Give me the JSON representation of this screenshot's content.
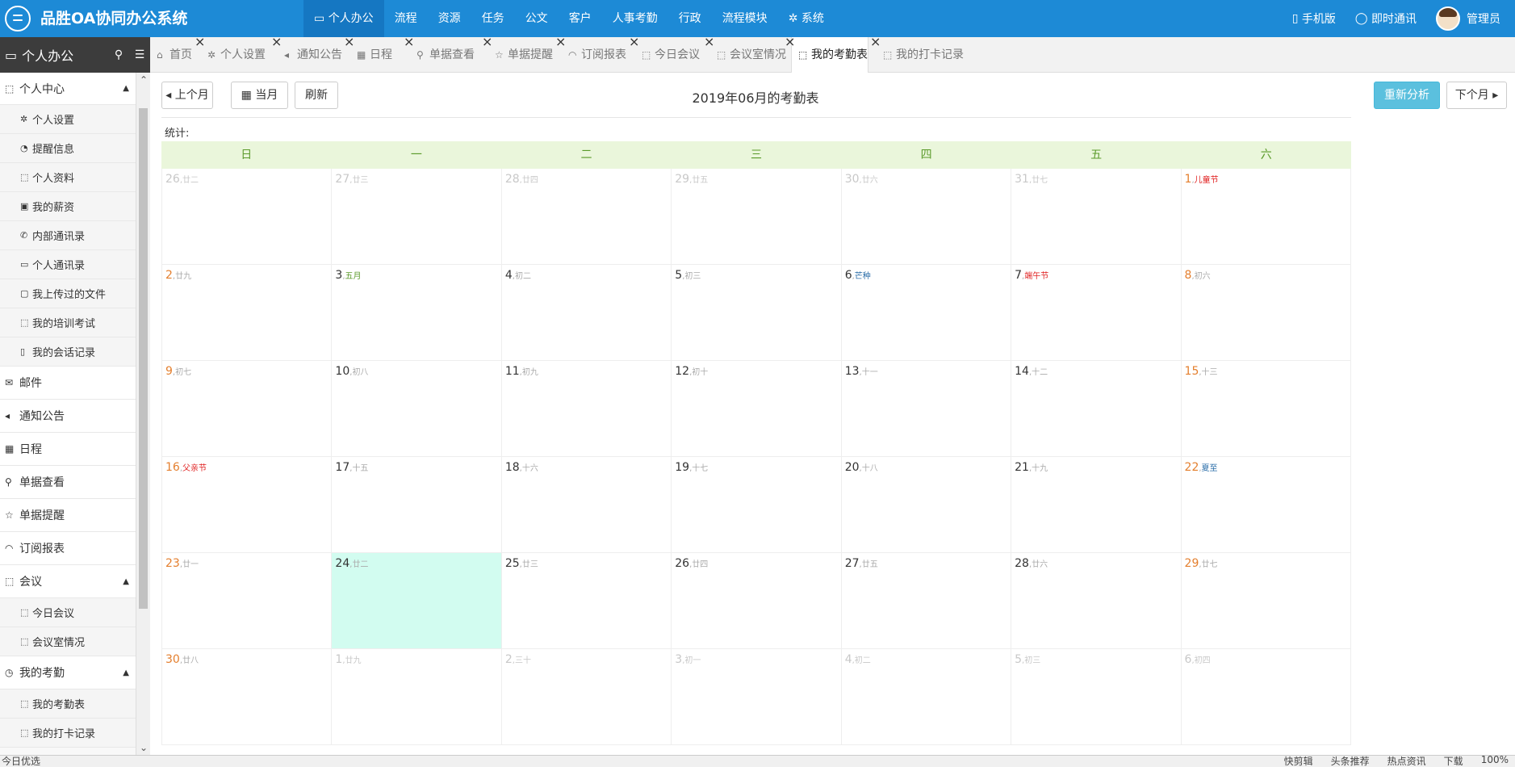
{
  "app": {
    "title": "品胜OA协同办公系统"
  },
  "topnav": [
    {
      "label": "个人办公",
      "icon": "▭",
      "active": true
    },
    {
      "label": "流程"
    },
    {
      "label": "资源"
    },
    {
      "label": "任务"
    },
    {
      "label": "公文"
    },
    {
      "label": "客户"
    },
    {
      "label": "人事考勤"
    },
    {
      "label": "行政"
    },
    {
      "label": "流程模块"
    },
    {
      "label": "系统",
      "icon": "✲"
    }
  ],
  "topright": {
    "mobile": "手机版",
    "im": "即时通讯",
    "user": "管理员"
  },
  "sidebar": {
    "title": "个人办公",
    "items": [
      {
        "label": "个人中心",
        "icon": "⬚",
        "type": "group-expanded",
        "caret": "▲"
      },
      {
        "label": "个人设置",
        "icon": "✲",
        "type": "sub"
      },
      {
        "label": "提醒信息",
        "icon": "◔",
        "type": "sub"
      },
      {
        "label": "个人资料",
        "icon": "⬚",
        "type": "sub"
      },
      {
        "label": "我的薪资",
        "icon": "▣",
        "type": "sub"
      },
      {
        "label": "内部通讯录",
        "icon": "✆",
        "type": "sub"
      },
      {
        "label": "个人通讯录",
        "icon": "▭",
        "type": "sub"
      },
      {
        "label": "我上传过的文件",
        "icon": "▢",
        "type": "sub"
      },
      {
        "label": "我的培训考试",
        "icon": "⬚",
        "type": "sub"
      },
      {
        "label": "我的会话记录",
        "icon": "▯",
        "type": "sub"
      },
      {
        "label": "邮件",
        "icon": "✉",
        "type": "group"
      },
      {
        "label": "通知公告",
        "icon": "◂",
        "type": "group"
      },
      {
        "label": "日程",
        "icon": "▦",
        "type": "group"
      },
      {
        "label": "单据查看",
        "icon": "⚲",
        "type": "group"
      },
      {
        "label": "单据提醒",
        "icon": "☆",
        "type": "group"
      },
      {
        "label": "订阅报表",
        "icon": "◠",
        "type": "group"
      },
      {
        "label": "会议",
        "icon": "⬚",
        "type": "group",
        "caret": "▲"
      },
      {
        "label": "今日会议",
        "icon": "⬚",
        "type": "sub"
      },
      {
        "label": "会议室情况",
        "icon": "⬚",
        "type": "sub"
      },
      {
        "label": "我的考勤",
        "icon": "◷",
        "type": "group",
        "caret": "▲"
      },
      {
        "label": "我的考勤表",
        "icon": "⬚",
        "type": "sub"
      },
      {
        "label": "我的打卡记录",
        "icon": "⬚",
        "type": "sub"
      }
    ]
  },
  "tabs": [
    {
      "label": "首页",
      "icon": "⌂"
    },
    {
      "label": "个人设置",
      "icon": "✲"
    },
    {
      "label": "通知公告",
      "icon": "◂"
    },
    {
      "label": "日程",
      "icon": "▦"
    },
    {
      "label": "单据查看",
      "icon": "⚲"
    },
    {
      "label": "单据提醒",
      "icon": "☆"
    },
    {
      "label": "订阅报表",
      "icon": "◠"
    },
    {
      "label": "今日会议",
      "icon": "⬚"
    },
    {
      "label": "会议室情况",
      "icon": "⬚"
    },
    {
      "label": "我的考勤表",
      "icon": "⬚",
      "active": true
    },
    {
      "label": "我的打卡记录",
      "icon": "⬚"
    }
  ],
  "toolbar": {
    "prev": "上个月",
    "current": "当月",
    "refresh": "刷新",
    "reanalyze": "重新分析",
    "next": "下个月"
  },
  "calendar": {
    "title": "2019年06月的考勤表",
    "stats_label": "统计:",
    "weekdays": [
      "日",
      "一",
      "二",
      "三",
      "四",
      "五",
      "六"
    ],
    "weeks": [
      [
        {
          "d": "26",
          "l": "廿二",
          "o": 1
        },
        {
          "d": "27",
          "l": "廿三",
          "o": 1
        },
        {
          "d": "28",
          "l": "廿四",
          "o": 1
        },
        {
          "d": "29",
          "l": "廿五",
          "o": 1
        },
        {
          "d": "30",
          "l": "廿六",
          "o": 1
        },
        {
          "d": "31",
          "l": "廿七",
          "o": 1
        },
        {
          "d": "1",
          "l": "儿童节",
          "t": "fest"
        }
      ],
      [
        {
          "d": "2",
          "l": "廿九"
        },
        {
          "d": "3",
          "l": "五月",
          "t": "month"
        },
        {
          "d": "4",
          "l": "初二"
        },
        {
          "d": "5",
          "l": "初三"
        },
        {
          "d": "6",
          "l": "芒种",
          "t": "term"
        },
        {
          "d": "7",
          "l": "端午节",
          "t": "fest"
        },
        {
          "d": "8",
          "l": "初六"
        }
      ],
      [
        {
          "d": "9",
          "l": "初七"
        },
        {
          "d": "10",
          "l": "初八"
        },
        {
          "d": "11",
          "l": "初九"
        },
        {
          "d": "12",
          "l": "初十"
        },
        {
          "d": "13",
          "l": "十一"
        },
        {
          "d": "14",
          "l": "十二"
        },
        {
          "d": "15",
          "l": "十三"
        }
      ],
      [
        {
          "d": "16",
          "l": "父亲节",
          "t": "fest"
        },
        {
          "d": "17",
          "l": "十五"
        },
        {
          "d": "18",
          "l": "十六"
        },
        {
          "d": "19",
          "l": "十七"
        },
        {
          "d": "20",
          "l": "十八"
        },
        {
          "d": "21",
          "l": "十九"
        },
        {
          "d": "22",
          "l": "夏至",
          "t": "term"
        }
      ],
      [
        {
          "d": "23",
          "l": "廿一"
        },
        {
          "d": "24",
          "l": "廿二",
          "today": 1
        },
        {
          "d": "25",
          "l": "廿三"
        },
        {
          "d": "26",
          "l": "廿四"
        },
        {
          "d": "27",
          "l": "廿五"
        },
        {
          "d": "28",
          "l": "廿六"
        },
        {
          "d": "29",
          "l": "廿七"
        }
      ],
      [
        {
          "d": "30",
          "l": "廿八"
        },
        {
          "d": "1",
          "l": "廿九",
          "o": 1
        },
        {
          "d": "2",
          "l": "三十",
          "o": 1
        },
        {
          "d": "3",
          "l": "初一",
          "o": 1
        },
        {
          "d": "4",
          "l": "初二",
          "o": 1
        },
        {
          "d": "5",
          "l": "初三",
          "o": 1
        },
        {
          "d": "6",
          "l": "初四",
          "o": 1
        }
      ]
    ]
  },
  "statusbar": {
    "left": "今日优选",
    "right": [
      "快剪辑",
      "头条推荐",
      "热点资讯",
      "下载",
      "100%"
    ]
  }
}
